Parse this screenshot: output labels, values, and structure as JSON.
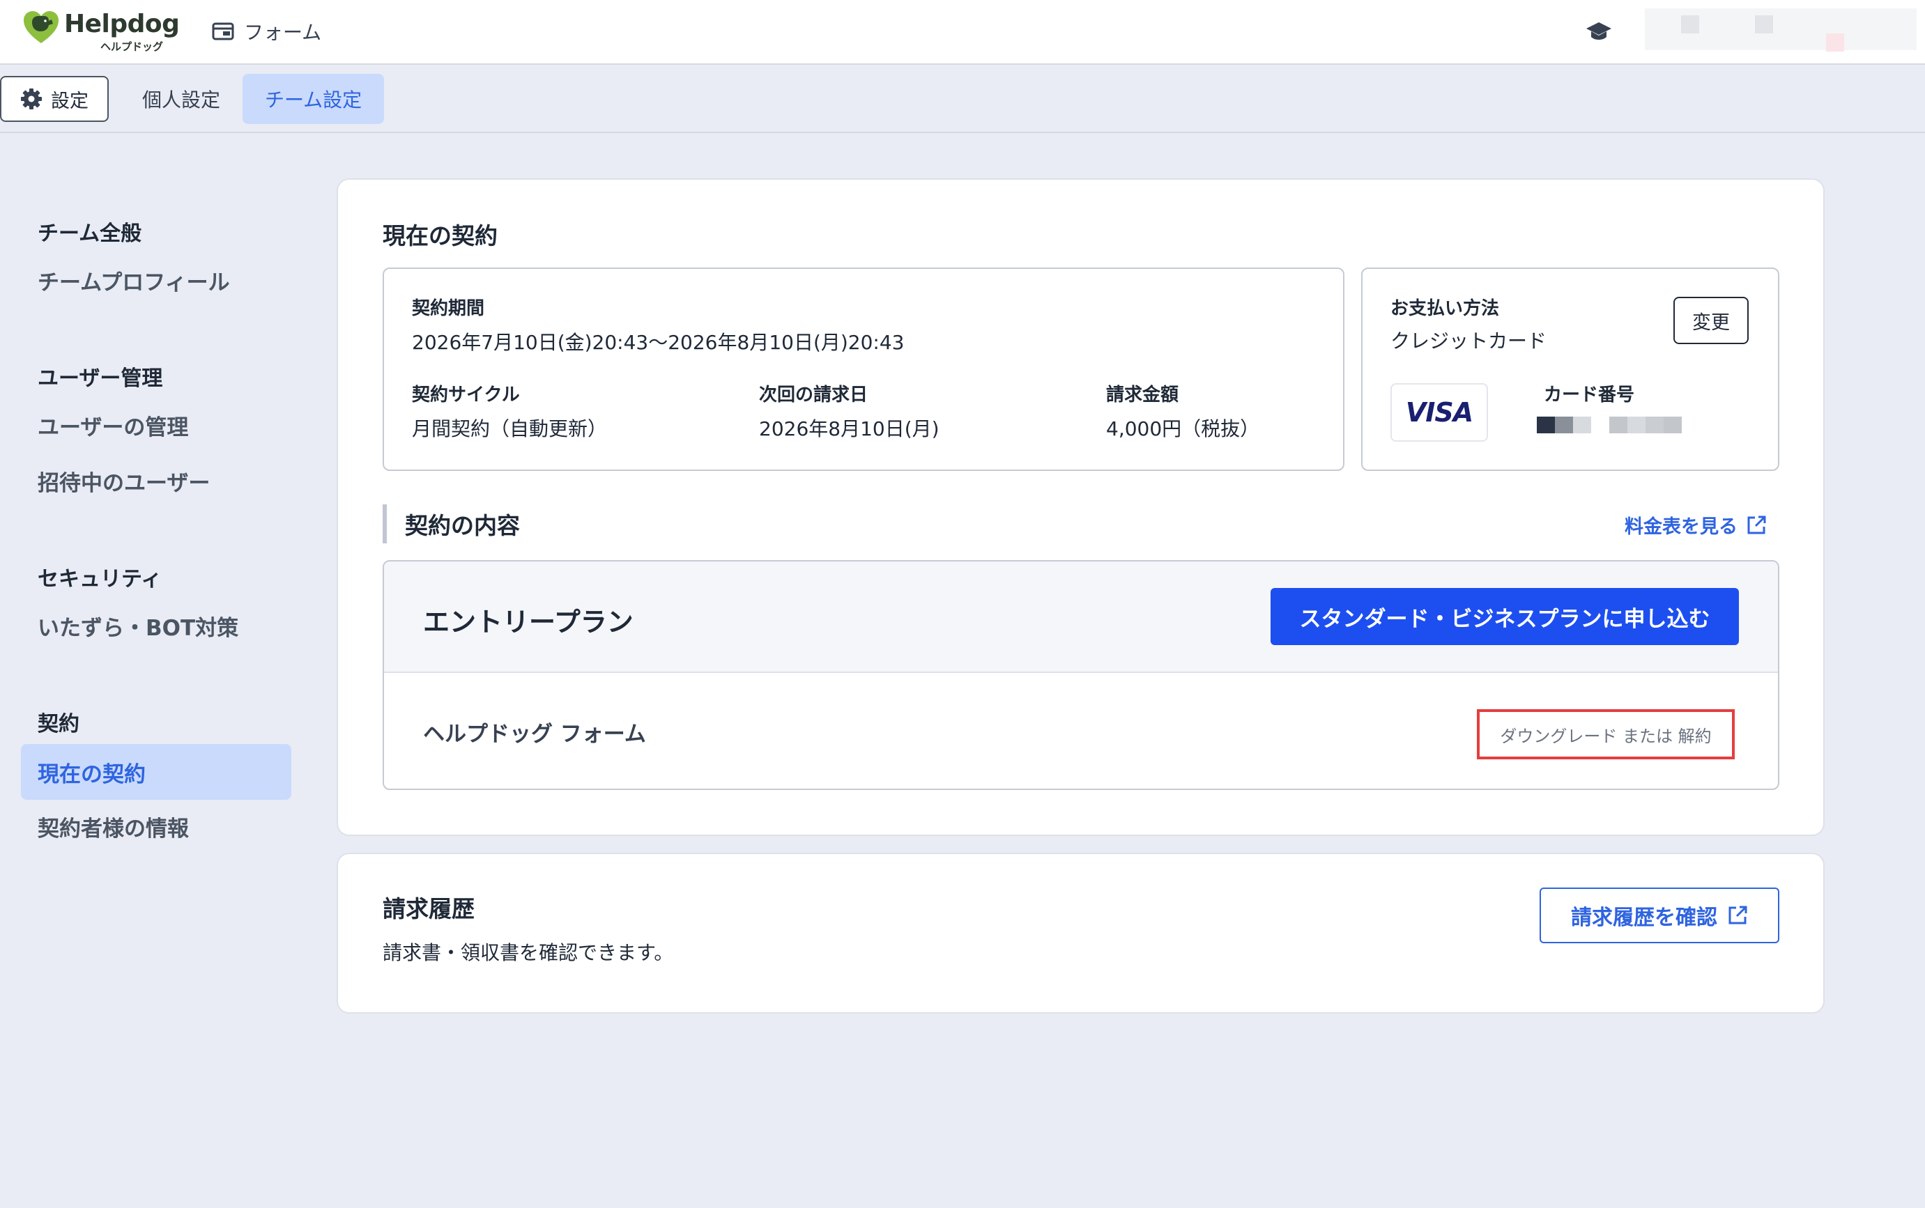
{
  "header": {
    "logo_text": "Helpdog",
    "logo_sub": "ヘルプドッグ",
    "app_label": "フォーム",
    "right_icon": "graduation-cap-icon"
  },
  "subnav": {
    "settings_label": "設定",
    "tab_personal": "個人設定",
    "tab_team": "チーム設定"
  },
  "sidebar": {
    "section_team": "チーム全般",
    "item_team_profile": "チームプロフィール",
    "section_users": "ユーザー管理",
    "item_user_manage": "ユーザーの管理",
    "item_invited": "招待中のユーザー",
    "section_security": "セキュリティ",
    "item_bot": "いたずら・BOT対策",
    "section_contract": "契約",
    "item_current_contract": "現在の契約",
    "item_contractor_info": "契約者様の情報"
  },
  "contract": {
    "title": "現在の契約",
    "period_label": "契約期間",
    "period_value": "2026年7月10日(金)20:43〜2026年8月10日(月)20:43",
    "cycle_label": "契約サイクル",
    "cycle_value": "月間契約（自動更新）",
    "next_bill_label": "次回の請求日",
    "next_bill_value": "2026年8月10日(月)",
    "amount_label": "請求金額",
    "amount_value": "4,000円（税抜）",
    "payment_label": "お支払い方法",
    "payment_value": "クレジットカード",
    "change_button": "変更",
    "card_brand": "VISA",
    "card_number_label": "カード番号",
    "content_title": "契約の内容",
    "pricing_link": "料金表を見る",
    "plan_name": "エントリープラン",
    "apply_button": "スタンダード・ビジネスプランに申し込む",
    "product_name": "ヘルプドッグ フォーム",
    "downgrade_link": "ダウングレード または 解約"
  },
  "billing": {
    "title": "請求履歴",
    "description": "請求書・領収書を確認できます。",
    "history_button": "請求履歴を確認"
  },
  "colors": {
    "primary": "#1d4ff0",
    "link": "#2f64e0",
    "active_bg": "#c9dafc",
    "highlight_border": "#e53e3e",
    "page_bg": "#e9ecf4"
  }
}
